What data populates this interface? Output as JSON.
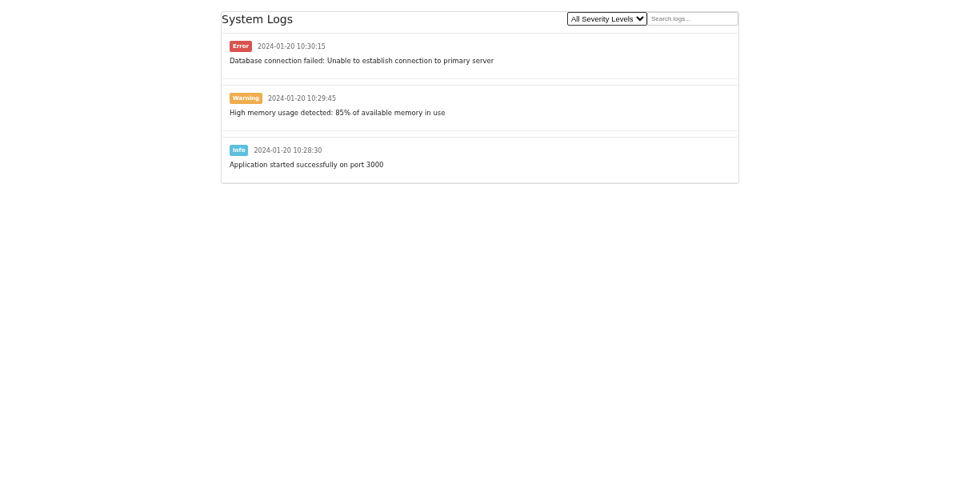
{
  "header": {
    "title": "System Logs",
    "severity_filter": {
      "value": "All Severity Levels"
    },
    "search": {
      "placeholder": "Search logs..."
    }
  },
  "logs": [
    {
      "severity": "Error",
      "color": "#d9534f",
      "timestamp": "2024-01-20 10:30:15",
      "message": "Database connection failed: Unable to establish connection to primary server"
    },
    {
      "severity": "Warning",
      "color": "#f0ad4e",
      "timestamp": "2024-01-20 10:29:45",
      "message": "High memory usage detected: 85% of available memory in use"
    },
    {
      "severity": "Info",
      "color": "#5bc0de",
      "timestamp": "2024-01-20 10:28:30",
      "message": "Application started successfully on port 3000"
    }
  ]
}
